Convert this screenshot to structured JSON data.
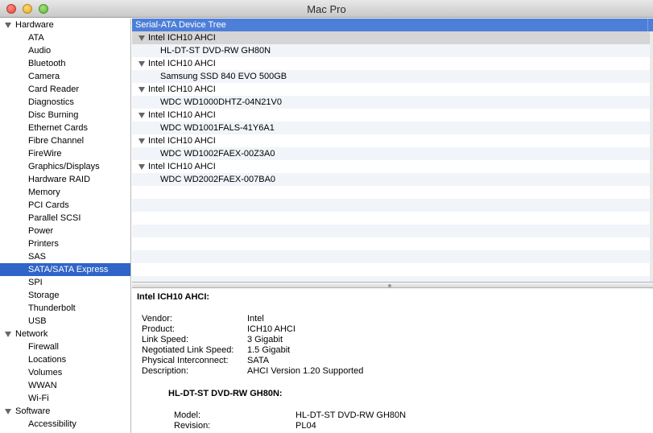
{
  "window": {
    "title": "Mac Pro"
  },
  "sidebar": {
    "rows": [
      {
        "type": "section",
        "label": "Hardware"
      },
      {
        "type": "item",
        "label": "ATA"
      },
      {
        "type": "item",
        "label": "Audio"
      },
      {
        "type": "item",
        "label": "Bluetooth"
      },
      {
        "type": "item",
        "label": "Camera"
      },
      {
        "type": "item",
        "label": "Card Reader"
      },
      {
        "type": "item",
        "label": "Diagnostics"
      },
      {
        "type": "item",
        "label": "Disc Burning"
      },
      {
        "type": "item",
        "label": "Ethernet Cards"
      },
      {
        "type": "item",
        "label": "Fibre Channel"
      },
      {
        "type": "item",
        "label": "FireWire"
      },
      {
        "type": "item",
        "label": "Graphics/Displays"
      },
      {
        "type": "item",
        "label": "Hardware RAID"
      },
      {
        "type": "item",
        "label": "Memory"
      },
      {
        "type": "item",
        "label": "PCI Cards"
      },
      {
        "type": "item",
        "label": "Parallel SCSI"
      },
      {
        "type": "item",
        "label": "Power"
      },
      {
        "type": "item",
        "label": "Printers"
      },
      {
        "type": "item",
        "label": "SAS"
      },
      {
        "type": "item",
        "label": "SATA/SATA Express",
        "selected": true
      },
      {
        "type": "item",
        "label": "SPI"
      },
      {
        "type": "item",
        "label": "Storage"
      },
      {
        "type": "item",
        "label": "Thunderbolt"
      },
      {
        "type": "item",
        "label": "USB"
      },
      {
        "type": "section",
        "label": "Network"
      },
      {
        "type": "item",
        "label": "Firewall"
      },
      {
        "type": "item",
        "label": "Locations"
      },
      {
        "type": "item",
        "label": "Volumes"
      },
      {
        "type": "item",
        "label": "WWAN"
      },
      {
        "type": "item",
        "label": "Wi-Fi"
      },
      {
        "type": "section",
        "label": "Software"
      },
      {
        "type": "item",
        "label": "Accessibility"
      }
    ]
  },
  "tree": {
    "header": "Serial-ATA Device Tree",
    "rows": [
      {
        "type": "controller",
        "label": "Intel ICH10 AHCI",
        "selected": true
      },
      {
        "type": "device",
        "label": "HL-DT-ST DVD-RW GH80N"
      },
      {
        "type": "controller",
        "label": "Intel ICH10 AHCI"
      },
      {
        "type": "device",
        "label": "Samsung SSD 840 EVO 500GB"
      },
      {
        "type": "controller",
        "label": "Intel ICH10 AHCI"
      },
      {
        "type": "device",
        "label": "WDC WD1000DHTZ-04N21V0"
      },
      {
        "type": "controller",
        "label": "Intel ICH10 AHCI"
      },
      {
        "type": "device",
        "label": "WDC WD1001FALS-41Y6A1"
      },
      {
        "type": "controller",
        "label": "Intel ICH10 AHCI"
      },
      {
        "type": "device",
        "label": "WDC WD1002FAEX-00Z3A0"
      },
      {
        "type": "controller",
        "label": "Intel ICH10 AHCI"
      },
      {
        "type": "device",
        "label": "WDC WD2002FAEX-007BA0"
      },
      {
        "type": "empty",
        "label": ""
      },
      {
        "type": "empty",
        "label": ""
      },
      {
        "type": "empty",
        "label": ""
      },
      {
        "type": "empty",
        "label": ""
      },
      {
        "type": "empty",
        "label": ""
      },
      {
        "type": "empty",
        "label": ""
      },
      {
        "type": "empty",
        "label": ""
      },
      {
        "type": "empty",
        "label": ""
      }
    ]
  },
  "detail": {
    "title": "Intel ICH10 AHCI:",
    "properties": [
      {
        "key": "Vendor:",
        "value": "Intel"
      },
      {
        "key": "Product:",
        "value": "ICH10 AHCI"
      },
      {
        "key": "Link Speed:",
        "value": "3 Gigabit"
      },
      {
        "key": "Negotiated Link Speed:",
        "value": "1.5 Gigabit"
      },
      {
        "key": "Physical Interconnect:",
        "value": "SATA"
      },
      {
        "key": "Description:",
        "value": "AHCI Version 1.20 Supported"
      }
    ],
    "device_title": "HL-DT-ST DVD-RW GH80N:",
    "device_properties": [
      {
        "key": "Model:",
        "value": "HL-DT-ST DVD-RW GH80N"
      },
      {
        "key": "Revision:",
        "value": "PL04"
      }
    ]
  }
}
